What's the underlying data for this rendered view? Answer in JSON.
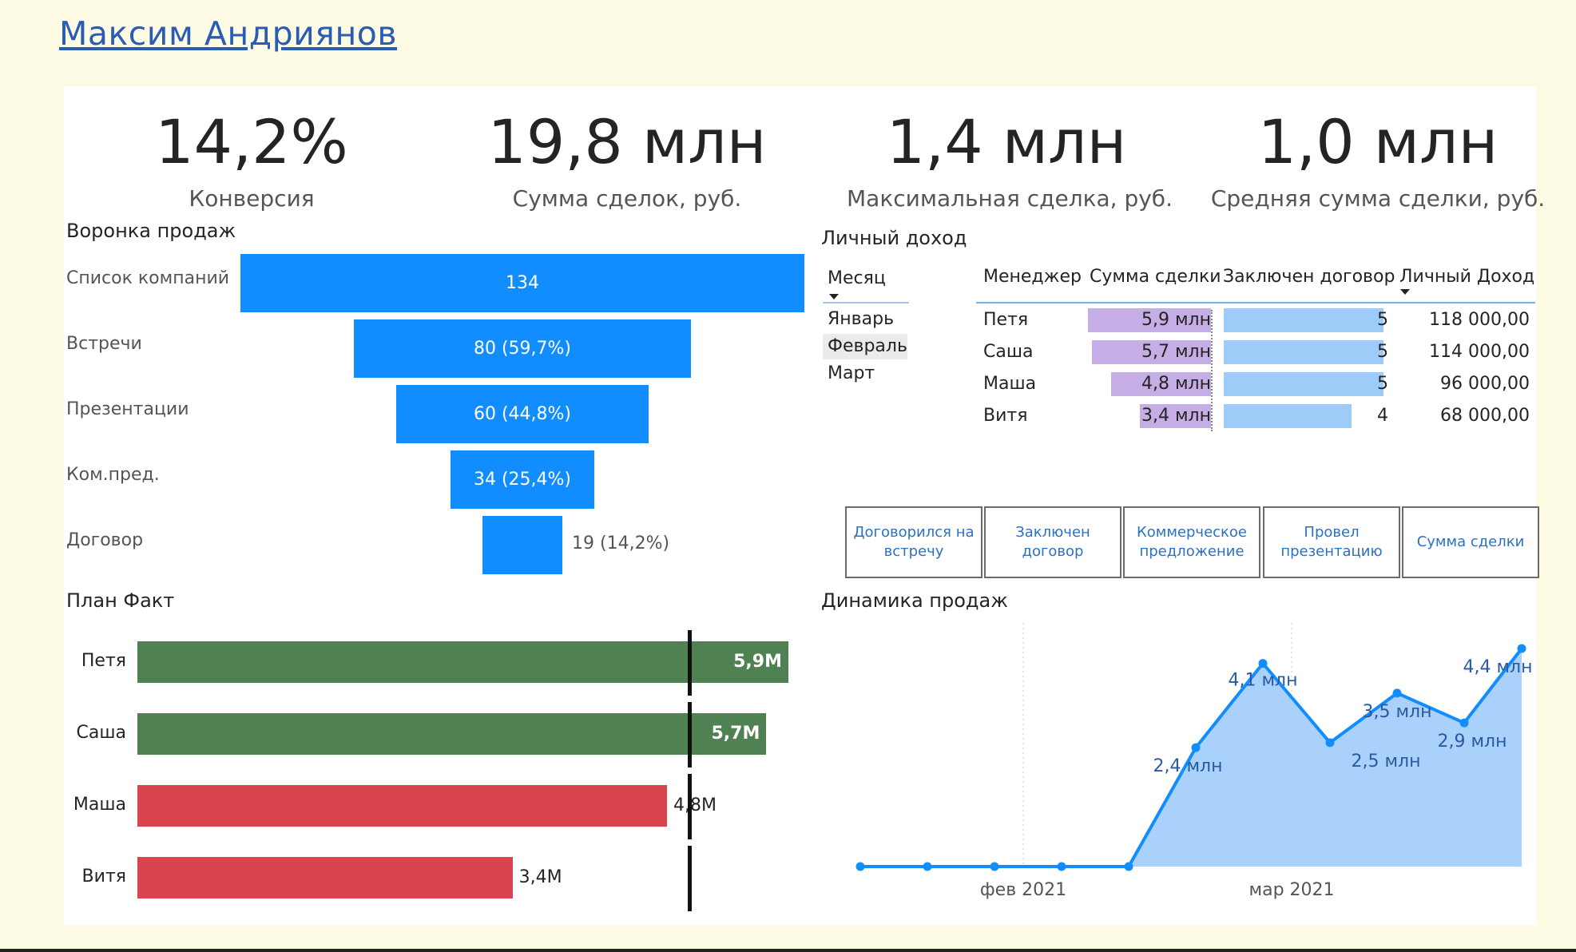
{
  "author": "Максим Андриянов",
  "kpis": [
    {
      "value": "14,2%",
      "label": "Конверсия"
    },
    {
      "value": "19,8 млн",
      "label": "Сумма сделок, руб."
    },
    {
      "value": "1,4 млн",
      "label": "Максимальная сделка, руб."
    },
    {
      "value": "1,0 млн",
      "label": "Средняя сумма сделки, руб."
    }
  ],
  "funnel": {
    "title": "Воронка продаж",
    "stages": [
      {
        "label": "Список компаний",
        "value": 134,
        "text": "134"
      },
      {
        "label": "Встречи",
        "value": 80,
        "text": "80 (59,7%)"
      },
      {
        "label": "Презентации",
        "value": 60,
        "text": "60 (44,8%)"
      },
      {
        "label": "Ком.пред.",
        "value": 34,
        "text": "34 (25,4%)"
      },
      {
        "label": "Договор",
        "value": 19,
        "text": "19 (14,2%)"
      }
    ],
    "color": "#118dff"
  },
  "income": {
    "title": "Личный доход",
    "slicer": {
      "title": "Месяц",
      "items": [
        "Январь",
        "Февраль",
        "Март"
      ],
      "selected": "Февраль"
    },
    "columns": [
      "Менеджер",
      "Сумма сделки",
      "Заключен договор",
      "Личный Доход"
    ],
    "rows": [
      {
        "manager": "Петя",
        "sum": 5.9,
        "sum_text": "5,9 млн",
        "deals": 5,
        "income": "118 000,00"
      },
      {
        "manager": "Саша",
        "sum": 5.7,
        "sum_text": "5,7 млн",
        "deals": 5,
        "income": "114 000,00"
      },
      {
        "manager": "Маша",
        "sum": 4.8,
        "sum_text": "4,8 млн",
        "deals": 5,
        "income": "96 000,00"
      },
      {
        "manager": "Витя",
        "sum": 3.4,
        "sum_text": "3,4 млн",
        "deals": 4,
        "income": "68 000,00"
      }
    ],
    "sum_color": "#c5ade6",
    "deals_color": "#9dccf8"
  },
  "buttons": [
    "Договорился на встречу",
    "Заключен договор",
    "Коммерческое предложение",
    "Провел презентацию",
    "Сумма сделки"
  ],
  "planfact": {
    "title": "План Факт",
    "target": 5.0,
    "rows": [
      {
        "name": "Петя",
        "value": 5.9,
        "text": "5,9M",
        "status": "above"
      },
      {
        "name": "Саша",
        "value": 5.7,
        "text": "5,7M",
        "status": "above"
      },
      {
        "name": "Маша",
        "value": 4.8,
        "text": "4,8M",
        "status": "below"
      },
      {
        "name": "Витя",
        "value": 3.4,
        "text": "3,4M",
        "status": "below"
      }
    ],
    "colors": {
      "above": "#4f8153",
      "below": "#d9444f"
    }
  },
  "chart_data": {
    "type": "area",
    "title": "Динамика продаж",
    "x_ticks": [
      "фев 2021",
      "мар 2021"
    ],
    "color": "#118dff",
    "fill": "#a9d1fb",
    "points": [
      {
        "y": 0,
        "label": ""
      },
      {
        "y": 0,
        "label": ""
      },
      {
        "y": 0,
        "label": ""
      },
      {
        "y": 0,
        "label": ""
      },
      {
        "y": 0,
        "label": ""
      },
      {
        "y": 2.4,
        "label": "2,4 млн"
      },
      {
        "y": 4.1,
        "label": "4,1 млн"
      },
      {
        "y": 2.5,
        "label": "2,5 млн"
      },
      {
        "y": 3.5,
        "label": "3,5 млн"
      },
      {
        "y": 2.9,
        "label": "2,9 млн"
      },
      {
        "y": 4.4,
        "label": "4,4 млн"
      }
    ]
  }
}
